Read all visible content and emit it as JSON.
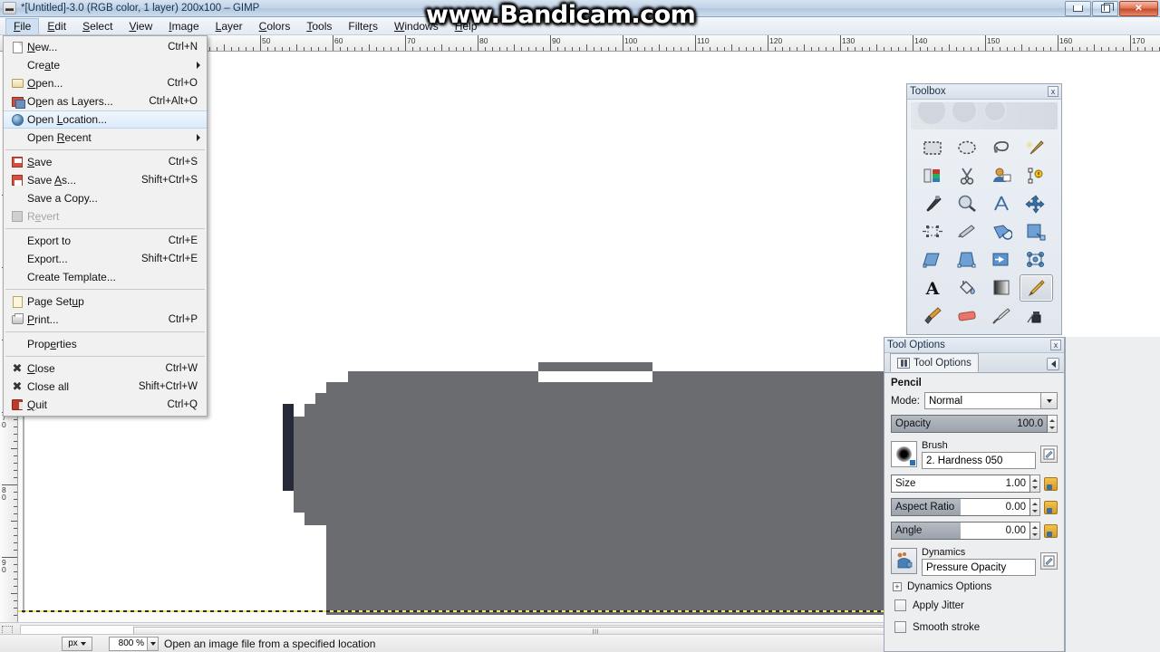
{
  "window": {
    "title": "*[Untitled]-3.0 (RGB color, 1 layer) 200x100 – GIMP",
    "app_icon": "gimp-window-icon",
    "minimize_label": "Minimize",
    "maximize_label": "Restore",
    "close_label": "Close"
  },
  "watermark": {
    "text": "www.Bandicam.com"
  },
  "menubar": {
    "items": [
      {
        "label": "File",
        "mnemonic": "F",
        "active": true
      },
      {
        "label": "Edit",
        "mnemonic": "E",
        "active": false
      },
      {
        "label": "Select",
        "mnemonic": "S",
        "active": false
      },
      {
        "label": "View",
        "mnemonic": "V",
        "active": false
      },
      {
        "label": "Image",
        "mnemonic": "I",
        "active": false
      },
      {
        "label": "Layer",
        "mnemonic": "L",
        "active": false
      },
      {
        "label": "Colors",
        "mnemonic": "C",
        "active": false
      },
      {
        "label": "Tools",
        "mnemonic": "T",
        "active": false
      },
      {
        "label": "Filters",
        "mnemonic": "r",
        "active": false
      },
      {
        "label": "Windows",
        "mnemonic": "W",
        "active": false
      },
      {
        "label": "Help",
        "mnemonic": "H",
        "active": false
      }
    ]
  },
  "file_menu": {
    "items": [
      {
        "type": "item",
        "label": "New...",
        "accel": "Ctrl+N",
        "icon": "new-document-icon",
        "selected": false,
        "disabled": false,
        "submenu": false
      },
      {
        "type": "item",
        "label": "Create",
        "accel": "",
        "icon": "",
        "selected": false,
        "disabled": false,
        "submenu": true
      },
      {
        "type": "item",
        "label": "Open...",
        "accel": "Ctrl+O",
        "icon": "open-folder-icon",
        "selected": false,
        "disabled": false,
        "submenu": false
      },
      {
        "type": "item",
        "label": "Open as Layers...",
        "accel": "Ctrl+Alt+O",
        "icon": "open-as-layers-icon",
        "selected": false,
        "disabled": false,
        "submenu": false
      },
      {
        "type": "item",
        "label": "Open Location...",
        "accel": "",
        "icon": "globe-icon",
        "selected": true,
        "disabled": false,
        "submenu": false
      },
      {
        "type": "item",
        "label": "Open Recent",
        "accel": "",
        "icon": "",
        "selected": false,
        "disabled": false,
        "submenu": true
      },
      {
        "type": "separator"
      },
      {
        "type": "item",
        "label": "Save",
        "accel": "Ctrl+S",
        "icon": "save-icon",
        "selected": false,
        "disabled": false,
        "submenu": false
      },
      {
        "type": "item",
        "label": "Save As...",
        "accel": "Shift+Ctrl+S",
        "icon": "save-as-icon",
        "selected": false,
        "disabled": false,
        "submenu": false
      },
      {
        "type": "item",
        "label": "Save a Copy...",
        "accel": "",
        "icon": "",
        "selected": false,
        "disabled": false,
        "submenu": false
      },
      {
        "type": "item",
        "label": "Revert",
        "accel": "",
        "icon": "revert-icon",
        "selected": false,
        "disabled": true,
        "submenu": false
      },
      {
        "type": "separator"
      },
      {
        "type": "item",
        "label": "Export to",
        "accel": "Ctrl+E",
        "icon": "",
        "selected": false,
        "disabled": false,
        "submenu": false
      },
      {
        "type": "item",
        "label": "Export...",
        "accel": "Shift+Ctrl+E",
        "icon": "",
        "selected": false,
        "disabled": false,
        "submenu": false
      },
      {
        "type": "item",
        "label": "Create Template...",
        "accel": "",
        "icon": "",
        "selected": false,
        "disabled": false,
        "submenu": false
      },
      {
        "type": "separator"
      },
      {
        "type": "item",
        "label": "Page Setup",
        "accel": "",
        "icon": "page-setup-icon",
        "selected": false,
        "disabled": false,
        "submenu": false
      },
      {
        "type": "item",
        "label": "Print...",
        "accel": "Ctrl+P",
        "icon": "printer-icon",
        "selected": false,
        "disabled": false,
        "submenu": false
      },
      {
        "type": "separator"
      },
      {
        "type": "item",
        "label": "Properties",
        "accel": "",
        "icon": "",
        "selected": false,
        "disabled": false,
        "submenu": false
      },
      {
        "type": "separator"
      },
      {
        "type": "item",
        "label": "Close",
        "accel": "Ctrl+W",
        "icon": "close-x-icon",
        "selected": false,
        "disabled": false,
        "submenu": false
      },
      {
        "type": "item",
        "label": "Close all",
        "accel": "Shift+Ctrl+W",
        "icon": "close-all-x-icon",
        "selected": false,
        "disabled": false,
        "submenu": false
      },
      {
        "type": "item",
        "label": "Quit",
        "accel": "Ctrl+Q",
        "icon": "quit-icon",
        "selected": false,
        "disabled": false,
        "submenu": false
      }
    ]
  },
  "rulers": {
    "unit": "px",
    "horizontal_labels": [
      "50",
      "60",
      "70",
      "80",
      "90",
      "100",
      "110",
      "120",
      "130",
      "140",
      "150",
      "160",
      "170"
    ],
    "vertical_labels": [
      "70",
      "80",
      "90"
    ]
  },
  "canvas": {
    "background": "#ffffff",
    "shape_fill": "#6b6c70",
    "shape_outline": "#262a38",
    "guide_color": "#f2e36b"
  },
  "toolbox": {
    "title": "Toolbox",
    "close_label": "x",
    "tools": [
      {
        "name": "rect-select-tool",
        "label": "Rectangle Select"
      },
      {
        "name": "ellipse-select-tool",
        "label": "Ellipse Select"
      },
      {
        "name": "free-select-tool",
        "label": "Free Select"
      },
      {
        "name": "fuzzy-select-tool",
        "label": "Fuzzy Select"
      },
      {
        "name": "select-by-color-tool",
        "label": "Select by Color"
      },
      {
        "name": "scissors-select-tool",
        "label": "Scissors Select"
      },
      {
        "name": "foreground-select-tool",
        "label": "Foreground Select"
      },
      {
        "name": "paths-tool",
        "label": "Paths"
      },
      {
        "name": "color-picker-tool",
        "label": "Color Picker"
      },
      {
        "name": "zoom-tool",
        "label": "Zoom"
      },
      {
        "name": "measure-tool",
        "label": "Measure"
      },
      {
        "name": "move-tool",
        "label": "Move"
      },
      {
        "name": "alignment-tool",
        "label": "Alignment"
      },
      {
        "name": "crop-tool",
        "label": "Crop"
      },
      {
        "name": "rotate-tool",
        "label": "Rotate"
      },
      {
        "name": "scale-tool",
        "label": "Scale"
      },
      {
        "name": "shear-tool",
        "label": "Shear"
      },
      {
        "name": "perspective-tool",
        "label": "Perspective"
      },
      {
        "name": "flip-tool",
        "label": "Flip"
      },
      {
        "name": "cage-transform-tool",
        "label": "Cage Transform"
      },
      {
        "name": "text-tool",
        "label": "Text"
      },
      {
        "name": "bucket-fill-tool",
        "label": "Bucket Fill"
      },
      {
        "name": "gradient-tool",
        "label": "Gradient"
      },
      {
        "name": "pencil-tool",
        "label": "Pencil"
      },
      {
        "name": "paintbrush-tool",
        "label": "Paintbrush"
      },
      {
        "name": "eraser-tool",
        "label": "Eraser"
      },
      {
        "name": "airbrush-tool",
        "label": "Airbrush"
      },
      {
        "name": "ink-tool",
        "label": "Ink"
      }
    ],
    "active_tool": "pencil-tool"
  },
  "tool_options": {
    "title": "Tool Options",
    "close_label": "x",
    "tab_label": "Tool Options",
    "tool_name": "Pencil",
    "mode_label": "Mode:",
    "mode_value": "Normal",
    "opacity_label": "Opacity",
    "opacity_value": "100.0",
    "brush_label": "Brush",
    "brush_value": "2. Hardness 050",
    "size_label": "Size",
    "size_value": "1.00",
    "aspect_label": "Aspect Ratio",
    "aspect_value": "0.00",
    "angle_label": "Angle",
    "angle_value": "0.00",
    "dynamics_label": "Dynamics",
    "dynamics_value": "Pressure Opacity",
    "dynamics_options_label": "Dynamics Options",
    "apply_jitter_label": "Apply Jitter",
    "apply_jitter_checked": false,
    "smooth_stroke_label": "Smooth stroke",
    "smooth_stroke_checked": false
  },
  "statusbar": {
    "unit": "px",
    "zoom": "800 %",
    "message": "Open an image file from a specified location"
  },
  "scrollbar": {
    "grip": "|||",
    "left_arrow": "◀",
    "right_arrow": "▶"
  }
}
